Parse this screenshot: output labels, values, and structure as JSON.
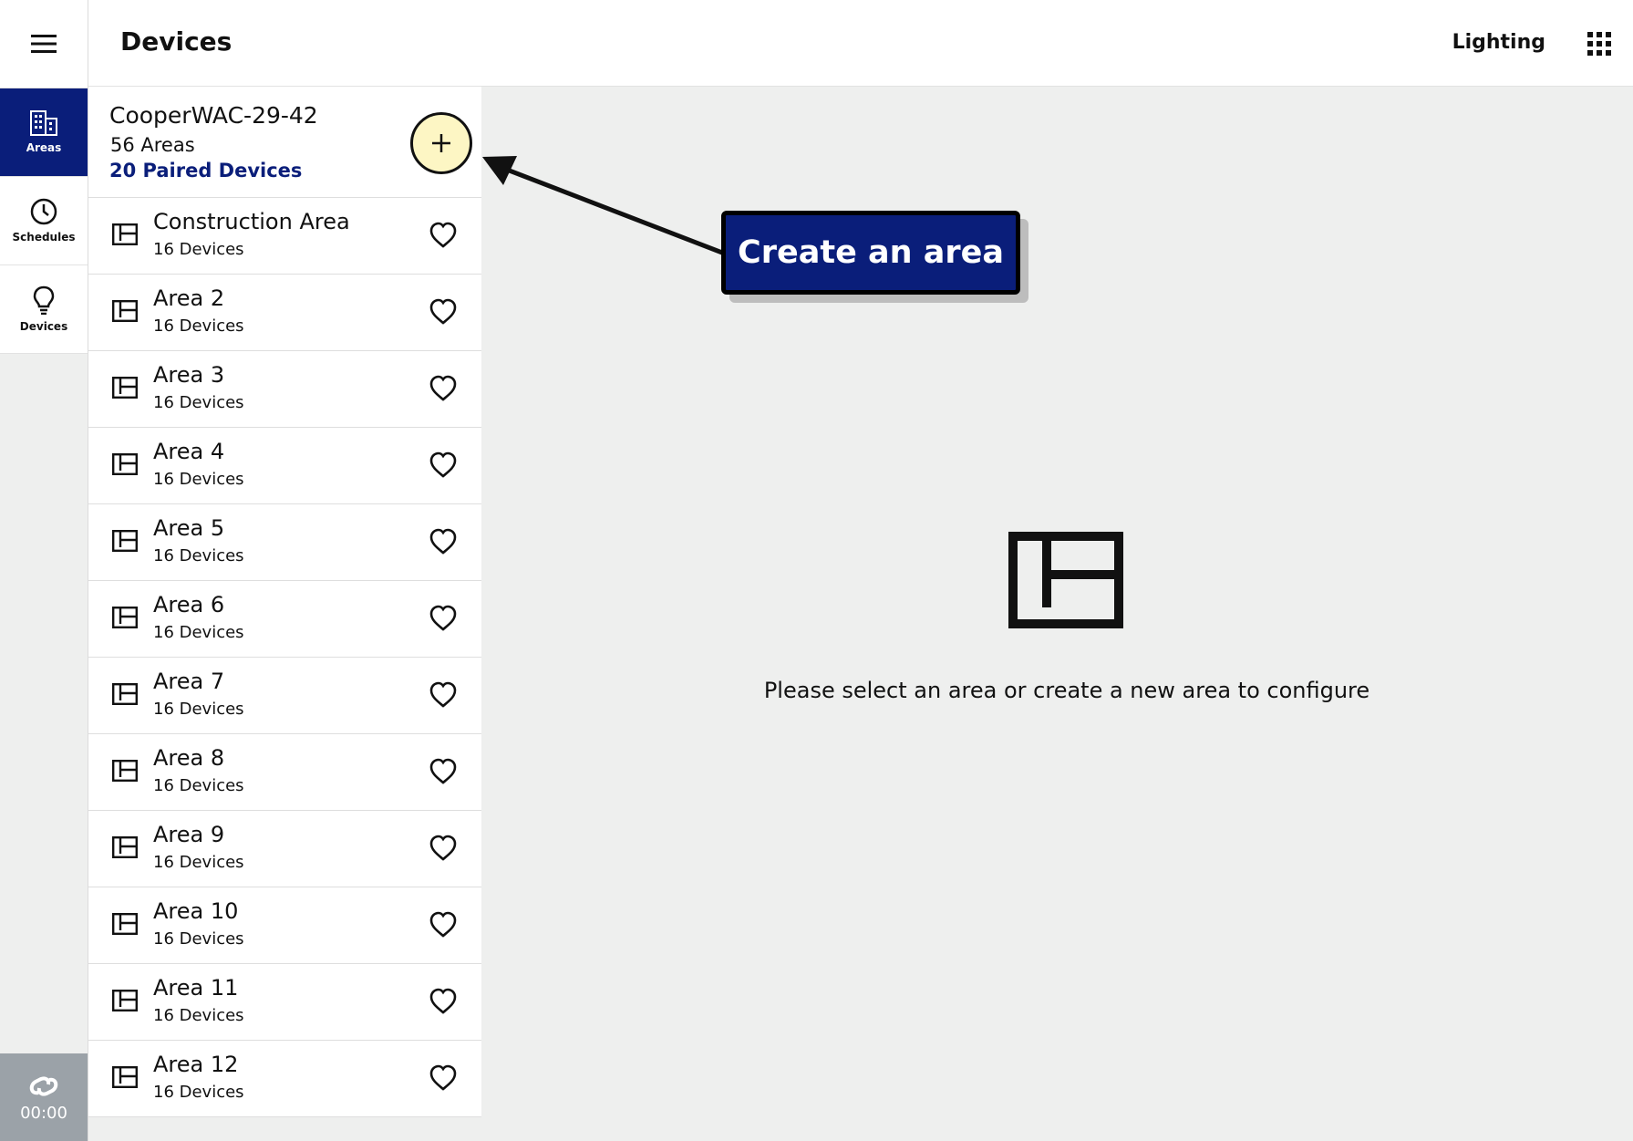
{
  "header": {
    "title": "Devices",
    "app_label": "Lighting"
  },
  "nav": {
    "items": [
      {
        "label": "Areas",
        "icon": "building-icon",
        "active": true
      },
      {
        "label": "Schedules",
        "icon": "clock-icon",
        "active": false
      },
      {
        "label": "Devices",
        "icon": "lightbulb-icon",
        "active": false
      }
    ],
    "status_time": "00:00"
  },
  "controller": {
    "name": "CooperWAC-29-42",
    "areas_text": "56 Areas",
    "paired_text": "20 Paired Devices"
  },
  "areas": [
    {
      "name": "Construction Area",
      "devices": "16 Devices"
    },
    {
      "name": "Area 2",
      "devices": "16 Devices"
    },
    {
      "name": "Area 3",
      "devices": "16 Devices"
    },
    {
      "name": "Area 4",
      "devices": "16 Devices"
    },
    {
      "name": "Area 5",
      "devices": "16 Devices"
    },
    {
      "name": "Area 6",
      "devices": "16 Devices"
    },
    {
      "name": "Area 7",
      "devices": "16 Devices"
    },
    {
      "name": "Area 8",
      "devices": "16 Devices"
    },
    {
      "name": "Area 9",
      "devices": "16 Devices"
    },
    {
      "name": "Area 10",
      "devices": "16 Devices"
    },
    {
      "name": "Area 11",
      "devices": "16 Devices"
    },
    {
      "name": "Area 12",
      "devices": "16 Devices"
    }
  ],
  "empty_state": {
    "message": "Please select an area or create a new area to configure"
  },
  "callout": {
    "text": "Create an area"
  },
  "colors": {
    "brand": "#0a1e7a",
    "add_button_fill": "#fdf6c4",
    "background": "#eeefee"
  }
}
